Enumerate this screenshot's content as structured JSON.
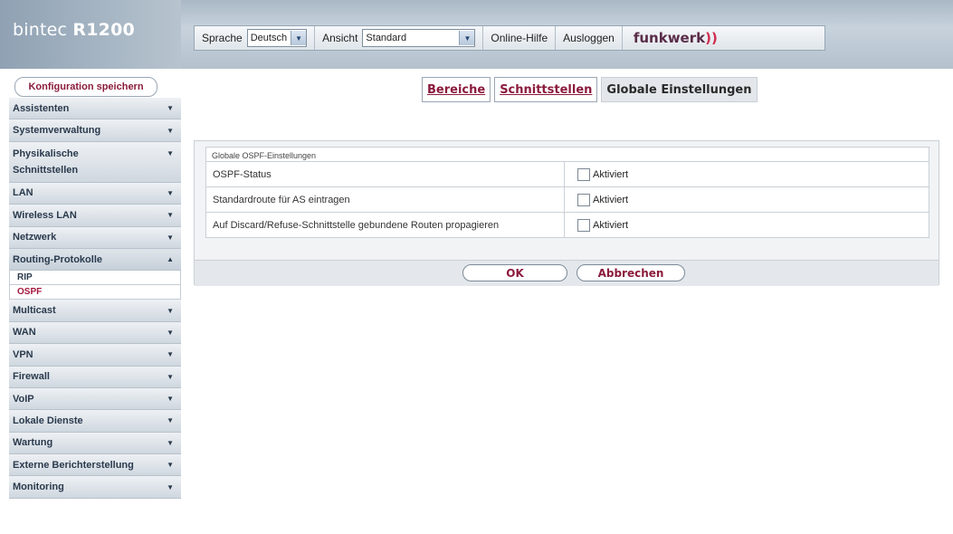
{
  "header": {
    "brand_prefix": "bintec",
    "brand_model": "R1200",
    "language_label": "Sprache",
    "language_value": "Deutsch",
    "view_label": "Ansicht",
    "view_value": "Standard",
    "help_label": "Online-Hilfe",
    "logout_label": "Ausloggen",
    "logo_text": "funkwerk",
    "logo_waves": "))"
  },
  "sidebar": {
    "save_label": "Konfiguration speichern",
    "items": [
      {
        "label": "Assistenten"
      },
      {
        "label": "Systemverwaltung"
      },
      {
        "label": "Physikalische Schnittstellen"
      },
      {
        "label": "LAN"
      },
      {
        "label": "Wireless LAN"
      },
      {
        "label": "Netzwerk"
      },
      {
        "label": "Routing-Protokolle"
      },
      {
        "label": "Multicast"
      },
      {
        "label": "WAN"
      },
      {
        "label": "VPN"
      },
      {
        "label": "Firewall"
      },
      {
        "label": "VoIP"
      },
      {
        "label": "Lokale Dienste"
      },
      {
        "label": "Wartung"
      },
      {
        "label": "Externe Berichterstellung"
      },
      {
        "label": "Monitoring"
      }
    ],
    "subitems": [
      {
        "label": "RIP"
      },
      {
        "label": "OSPF"
      }
    ]
  },
  "tabs": [
    {
      "label": "Bereiche"
    },
    {
      "label": "Schnittstellen"
    },
    {
      "label": "Globale Einstellungen"
    }
  ],
  "form": {
    "section_title": "Globale OSPF-Einstellungen",
    "rows": [
      {
        "label": "OSPF-Status",
        "checkbox_label": "Aktiviert",
        "checked": false
      },
      {
        "label": "Standardroute für AS eintragen",
        "checkbox_label": "Aktiviert",
        "checked": false
      },
      {
        "label": "Auf Discard/Refuse-Schnittstelle gebundene Routen propagieren",
        "checkbox_label": "Aktiviert",
        "checked": false
      }
    ],
    "ok_label": "OK",
    "cancel_label": "Abbrechen"
  },
  "colors": {
    "accent": "#8b1b3c",
    "header": "#b4c1cd",
    "panel": "#f1f3f5"
  }
}
